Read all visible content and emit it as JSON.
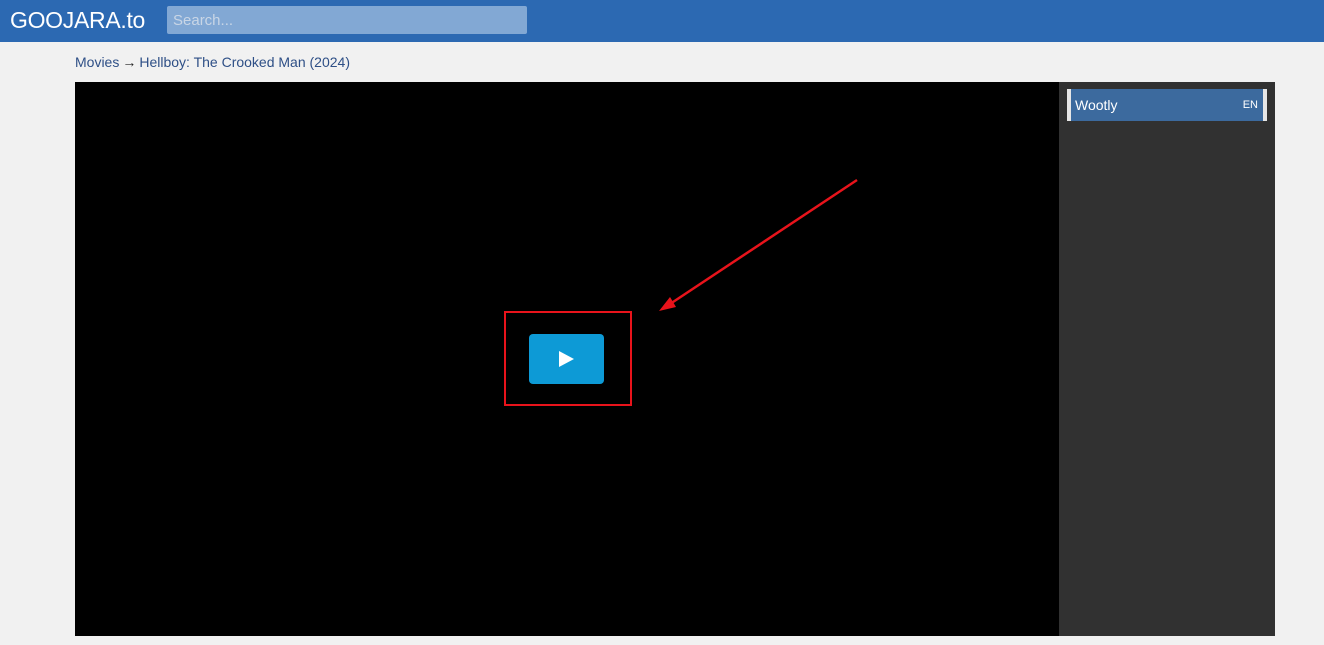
{
  "header": {
    "logo": "GOOJARA.to",
    "search_placeholder": "Search..."
  },
  "breadcrumb": {
    "parent": "Movies",
    "separator": "→",
    "current": "Hellboy: The Crooked Man (2024)"
  },
  "player": {
    "play_icon": "play-icon"
  },
  "sidebar": {
    "servers": [
      {
        "name": "Wootly",
        "lang": "EN"
      }
    ]
  },
  "colors": {
    "header_bg": "#2c69b2",
    "play_button": "#0d9ad6",
    "annotation": "#e8131b",
    "server_item": "#3c6a9e"
  }
}
